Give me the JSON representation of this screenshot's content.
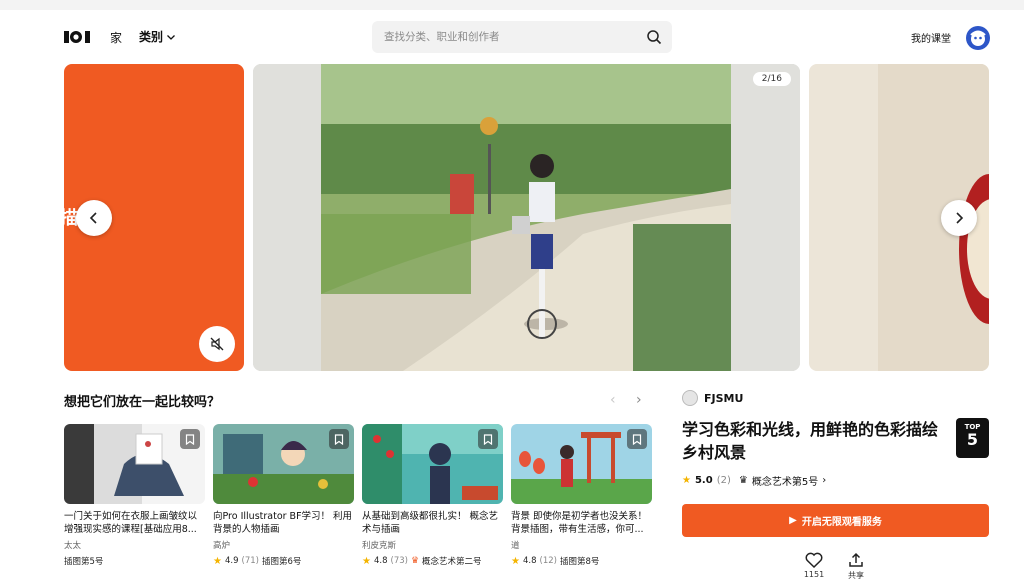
{
  "header": {
    "nav_home": "家",
    "nav_categories": "类别",
    "search_placeholder": "查找分类、职业和创作者",
    "my_classroom": "我的课堂"
  },
  "carousel": {
    "left_card_text": "描",
    "slide_counter": "2/16"
  },
  "compare": {
    "title": "想把它们放在一起比较吗？",
    "courses": [
      {
        "title": "一门关于如何在衣服上画皱纹以增强现实感的课程[基础应用8...",
        "author": "太太",
        "rating": "",
        "count": "",
        "rank": "插图第5号"
      },
      {
        "title": "向Pro Illustrator BF学习！ 利用背景的人物插画",
        "author": "高炉",
        "rating": "4.9",
        "count": "(71)",
        "rank": "插图第6号"
      },
      {
        "title": "从基础到高级都很扎实！ 概念艺术与插画",
        "author": "利皮克斯",
        "rating": "4.8",
        "count": "(73)",
        "rank": "概念艺术第二号"
      },
      {
        "title": "背景 即使你是初学者也没关系！ 背景插图，带有生活感，你可...",
        "author": "道",
        "rating": "4.8",
        "count": "(12)",
        "rank": "插图第8号"
      }
    ]
  },
  "detail": {
    "instructor": "FJSMU",
    "title": "学习色彩和光线，用鲜艳的色彩描绘乡村风景",
    "badge_top": "TOP",
    "badge_num": "5",
    "rating": "5.0",
    "count": "(2)",
    "rank": "概念艺术第5号",
    "rank_arrow": "›",
    "subscribe": "开启无限观看服务",
    "like_count": "1151",
    "share": "共享"
  },
  "colors": {
    "accent": "#f05a22",
    "star": "#f4b400",
    "dark": "#111111"
  }
}
